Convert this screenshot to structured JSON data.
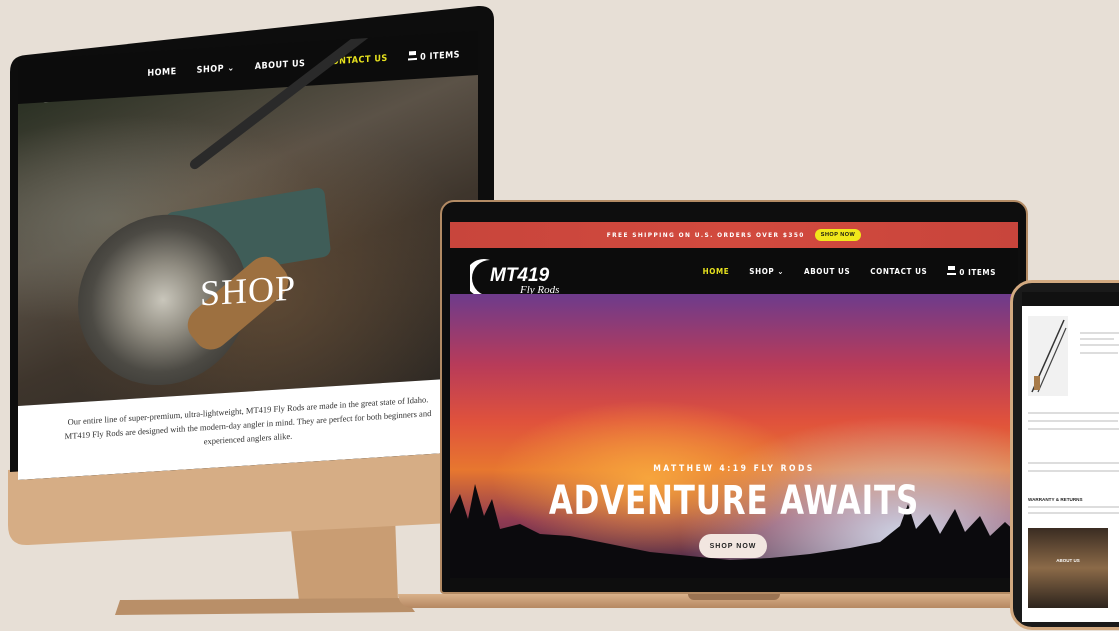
{
  "desktop": {
    "nav": {
      "home": "HOME",
      "shop": "SHOP",
      "about": "ABOUT US",
      "contact": "CONTACT US",
      "cart": "0 ITEMS"
    },
    "hero_title": "SHOP",
    "description": "Our entire line of super-premium, ultra-lightweight, MT419 Fly Rods are made in the great state of Idaho. MT419 Fly Rods are designed with the modern-day angler in mind. They are perfect for both beginners and experienced anglers alike."
  },
  "laptop": {
    "promo_text": "FREE SHIPPING ON U.S. ORDERS OVER $350",
    "promo_button": "SHOP NOW",
    "nav": {
      "home": "HOME",
      "shop": "SHOP",
      "about": "ABOUT US",
      "contact": "CONTACT US",
      "cart": "0 ITEMS"
    },
    "hero_subtitle": "MATTHEW 4:19 FLY RODS",
    "hero_title": "ADVENTURE AWAITS",
    "hero_button": "SHOP NOW"
  },
  "phone": {
    "section_title": "WARRANTY & RETURNS",
    "image_caption": "ABOUT US"
  },
  "colors": {
    "accent": "#e7e21e",
    "promo": "#d24a3e",
    "device_gold": "#d2a980"
  }
}
